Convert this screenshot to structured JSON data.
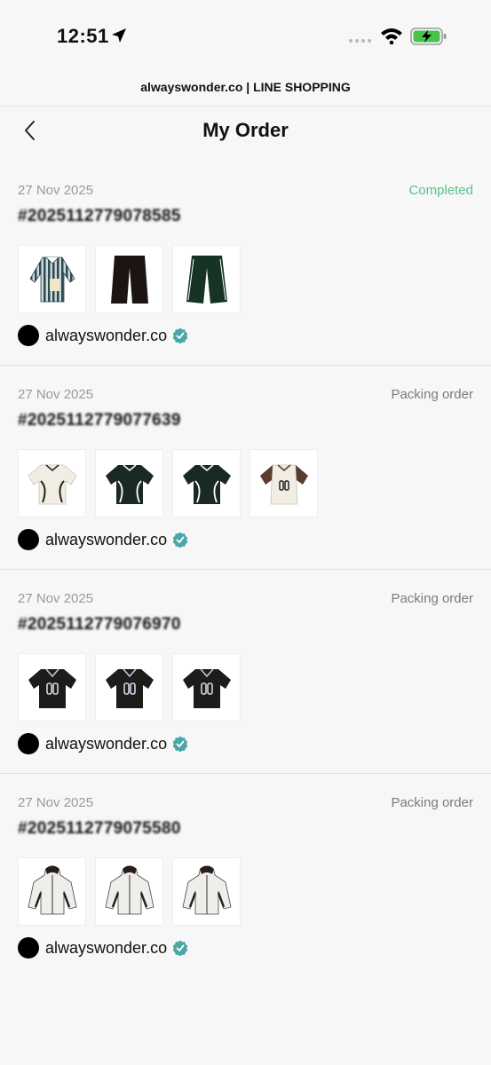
{
  "status_bar": {
    "time": "12:51"
  },
  "header": {
    "site_title": "alwayswonder.co | LINE SHOPPING",
    "page_title": "My Order"
  },
  "colors": {
    "completed": "#55c58a",
    "verified": "#4aa7a6"
  },
  "orders": [
    {
      "date": "27 Nov 2025",
      "status": "Completed",
      "order_number": "#2025112779078585",
      "shop": "alwayswonder.co",
      "items": [
        "striped-shirt",
        "black-pants",
        "green-pants"
      ]
    },
    {
      "date": "27 Nov 2025",
      "status": "Packing order",
      "order_number": "#2025112779077639",
      "shop": "alwayswonder.co",
      "items": [
        "cream-jersey",
        "green-jersey",
        "green-jersey",
        "cream-brown-jersey"
      ]
    },
    {
      "date": "27 Nov 2025",
      "status": "Packing order",
      "order_number": "#2025112779076970",
      "shop": "alwayswonder.co",
      "items": [
        "black-jersey",
        "black-jersey",
        "black-jersey"
      ]
    },
    {
      "date": "27 Nov 2025",
      "status": "Packing order",
      "order_number": "#2025112779075580",
      "shop": "alwayswonder.co",
      "items": [
        "white-jacket",
        "white-jacket",
        "white-jacket"
      ]
    }
  ]
}
